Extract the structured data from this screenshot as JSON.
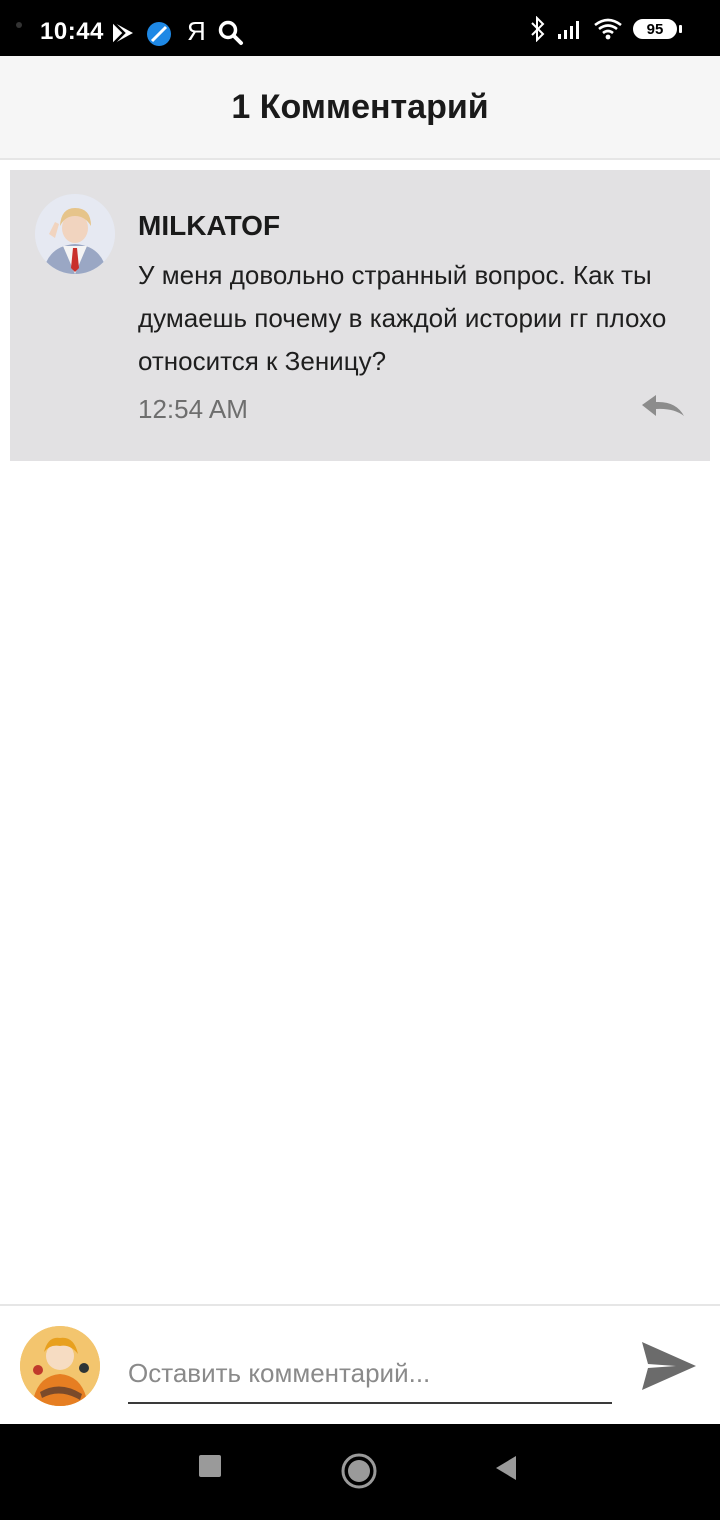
{
  "status_bar": {
    "time": "10:44",
    "yandex_letter": "Я",
    "battery": "95",
    "icons": [
      "play-store-icon",
      "browser-icon",
      "yandex-icon",
      "search-icon",
      "bluetooth-icon",
      "signal-icon",
      "wifi-icon",
      "battery-icon"
    ]
  },
  "header": {
    "title": "1 Комментарий"
  },
  "comments": [
    {
      "username": "MILKATOF",
      "text": "У меня довольно странный вопрос. Как ты думаешь почему в каждой истории гг плохо относится к Зеницу?",
      "time": "12:54 AM",
      "reply_icon": "reply-icon"
    }
  ],
  "composer": {
    "placeholder": "Оставить комментарий...",
    "value": "",
    "send_icon": "send-icon"
  },
  "nav_bar": {
    "icons": [
      "recents-square-icon",
      "home-circle-icon",
      "back-triangle-icon"
    ]
  },
  "colors": {
    "card_bg": "#e2e1e3",
    "header_bg": "#f6f6f6",
    "icon_gray": "#8c8c8c"
  }
}
